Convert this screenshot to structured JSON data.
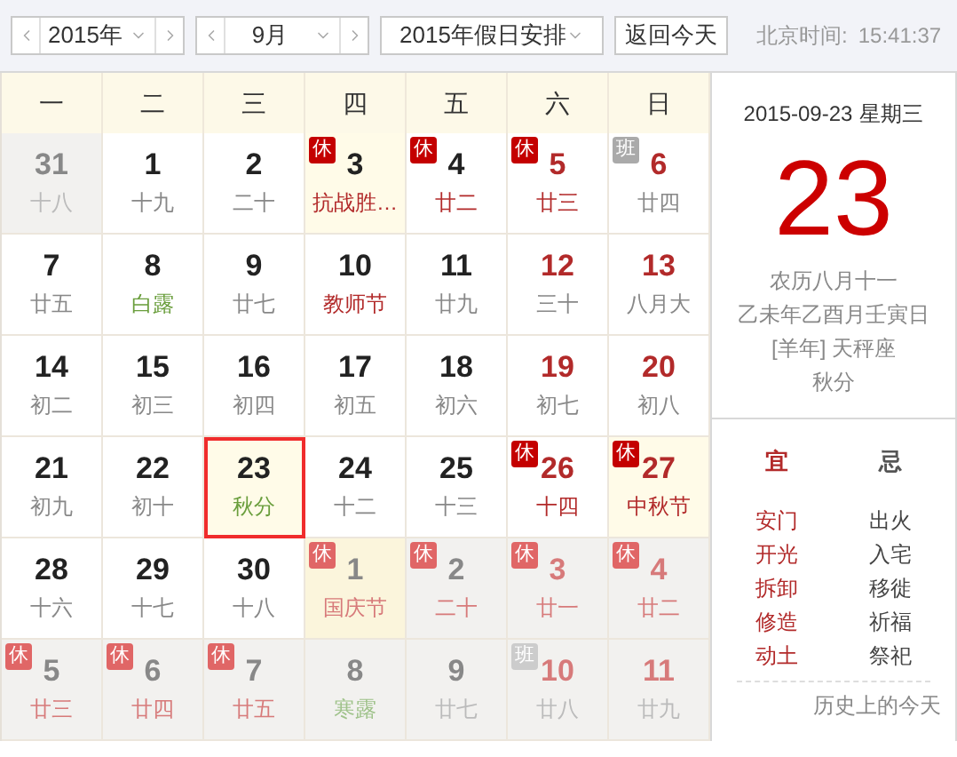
{
  "toolbar": {
    "year": "2015年",
    "month": "9月",
    "holiday_select": "2015年假日安排",
    "today_button": "返回今天",
    "clock_label": "北京时间:",
    "clock_time": "15:41:37"
  },
  "weekdays": [
    "一",
    "二",
    "三",
    "四",
    "五",
    "六",
    "日"
  ],
  "weeks": [
    [
      {
        "day": "31",
        "lunar": {
          "text": "十八",
          "kind": "plain"
        },
        "in_month": false,
        "highlight": false,
        "selected": false
      },
      {
        "day": "1",
        "lunar": {
          "text": "十九",
          "kind": "plain"
        },
        "in_month": true,
        "highlight": false,
        "selected": false
      },
      {
        "day": "2",
        "lunar": {
          "text": "二十",
          "kind": "plain"
        },
        "in_month": true,
        "highlight": false,
        "selected": false
      },
      {
        "day": "3",
        "lunar": {
          "text": "抗战胜…",
          "kind": "holiday"
        },
        "badge": {
          "text": "休",
          "kind": "rest"
        },
        "in_month": true,
        "highlight": true,
        "selected": false
      },
      {
        "day": "4",
        "lunar": {
          "text": "廿二",
          "kind": "holiday"
        },
        "badge": {
          "text": "休",
          "kind": "rest"
        },
        "in_month": true,
        "highlight": false,
        "selected": false
      },
      {
        "day": "5",
        "lunar": {
          "text": "廿三",
          "kind": "holiday"
        },
        "badge": {
          "text": "休",
          "kind": "rest"
        },
        "in_month": true,
        "highlight": false,
        "selected": false
      },
      {
        "day": "6",
        "lunar": {
          "text": "廿四",
          "kind": "plain"
        },
        "badge": {
          "text": "班",
          "kind": "work"
        },
        "in_month": true,
        "highlight": false,
        "selected": false
      }
    ],
    [
      {
        "day": "7",
        "lunar": {
          "text": "廿五",
          "kind": "plain"
        },
        "in_month": true,
        "highlight": false,
        "selected": false
      },
      {
        "day": "8",
        "lunar": {
          "text": "白露",
          "kind": "term"
        },
        "in_month": true,
        "highlight": false,
        "selected": false
      },
      {
        "day": "9",
        "lunar": {
          "text": "廿七",
          "kind": "plain"
        },
        "in_month": true,
        "highlight": false,
        "selected": false
      },
      {
        "day": "10",
        "lunar": {
          "text": "教师节",
          "kind": "holiday"
        },
        "in_month": true,
        "highlight": false,
        "selected": false
      },
      {
        "day": "11",
        "lunar": {
          "text": "廿九",
          "kind": "plain"
        },
        "in_month": true,
        "highlight": false,
        "selected": false
      },
      {
        "day": "12",
        "lunar": {
          "text": "三十",
          "kind": "plain"
        },
        "in_month": true,
        "highlight": false,
        "selected": false
      },
      {
        "day": "13",
        "lunar": {
          "text": "八月大",
          "kind": "plain"
        },
        "in_month": true,
        "highlight": false,
        "selected": false
      }
    ],
    [
      {
        "day": "14",
        "lunar": {
          "text": "初二",
          "kind": "plain"
        },
        "in_month": true,
        "highlight": false,
        "selected": false
      },
      {
        "day": "15",
        "lunar": {
          "text": "初三",
          "kind": "plain"
        },
        "in_month": true,
        "highlight": false,
        "selected": false
      },
      {
        "day": "16",
        "lunar": {
          "text": "初四",
          "kind": "plain"
        },
        "in_month": true,
        "highlight": false,
        "selected": false
      },
      {
        "day": "17",
        "lunar": {
          "text": "初五",
          "kind": "plain"
        },
        "in_month": true,
        "highlight": false,
        "selected": false
      },
      {
        "day": "18",
        "lunar": {
          "text": "初六",
          "kind": "plain"
        },
        "in_month": true,
        "highlight": false,
        "selected": false
      },
      {
        "day": "19",
        "lunar": {
          "text": "初七",
          "kind": "plain"
        },
        "in_month": true,
        "highlight": false,
        "selected": false
      },
      {
        "day": "20",
        "lunar": {
          "text": "初八",
          "kind": "plain"
        },
        "in_month": true,
        "highlight": false,
        "selected": false
      }
    ],
    [
      {
        "day": "21",
        "lunar": {
          "text": "初九",
          "kind": "plain"
        },
        "in_month": true,
        "highlight": false,
        "selected": false
      },
      {
        "day": "22",
        "lunar": {
          "text": "初十",
          "kind": "plain"
        },
        "in_month": true,
        "highlight": false,
        "selected": false
      },
      {
        "day": "23",
        "lunar": {
          "text": "秋分",
          "kind": "term"
        },
        "in_month": true,
        "highlight": true,
        "selected": true
      },
      {
        "day": "24",
        "lunar": {
          "text": "十二",
          "kind": "plain"
        },
        "in_month": true,
        "highlight": false,
        "selected": false
      },
      {
        "day": "25",
        "lunar": {
          "text": "十三",
          "kind": "plain"
        },
        "in_month": true,
        "highlight": false,
        "selected": false
      },
      {
        "day": "26",
        "lunar": {
          "text": "十四",
          "kind": "holiday"
        },
        "badge": {
          "text": "休",
          "kind": "rest"
        },
        "in_month": true,
        "highlight": false,
        "selected": false
      },
      {
        "day": "27",
        "lunar": {
          "text": "中秋节",
          "kind": "holiday"
        },
        "badge": {
          "text": "休",
          "kind": "rest"
        },
        "in_month": true,
        "highlight": true,
        "selected": false
      }
    ],
    [
      {
        "day": "28",
        "lunar": {
          "text": "十六",
          "kind": "plain"
        },
        "in_month": true,
        "highlight": false,
        "selected": false
      },
      {
        "day": "29",
        "lunar": {
          "text": "十七",
          "kind": "plain"
        },
        "in_month": true,
        "highlight": false,
        "selected": false
      },
      {
        "day": "30",
        "lunar": {
          "text": "十八",
          "kind": "plain"
        },
        "in_month": true,
        "highlight": false,
        "selected": false
      },
      {
        "day": "1",
        "lunar": {
          "text": "国庆节",
          "kind": "holiday"
        },
        "badge": {
          "text": "休",
          "kind": "rest"
        },
        "in_month": false,
        "highlight": true,
        "selected": false
      },
      {
        "day": "2",
        "lunar": {
          "text": "二十",
          "kind": "holiday"
        },
        "badge": {
          "text": "休",
          "kind": "rest"
        },
        "in_month": false,
        "highlight": false,
        "selected": false
      },
      {
        "day": "3",
        "lunar": {
          "text": "廿一",
          "kind": "holiday"
        },
        "badge": {
          "text": "休",
          "kind": "rest"
        },
        "in_month": false,
        "highlight": false,
        "selected": false
      },
      {
        "day": "4",
        "lunar": {
          "text": "廿二",
          "kind": "holiday"
        },
        "badge": {
          "text": "休",
          "kind": "rest"
        },
        "in_month": false,
        "highlight": false,
        "selected": false
      }
    ],
    [
      {
        "day": "5",
        "lunar": {
          "text": "廿三",
          "kind": "holiday"
        },
        "badge": {
          "text": "休",
          "kind": "rest"
        },
        "in_month": false,
        "highlight": false,
        "selected": false
      },
      {
        "day": "6",
        "lunar": {
          "text": "廿四",
          "kind": "holiday"
        },
        "badge": {
          "text": "休",
          "kind": "rest"
        },
        "in_month": false,
        "highlight": false,
        "selected": false
      },
      {
        "day": "7",
        "lunar": {
          "text": "廿五",
          "kind": "holiday"
        },
        "badge": {
          "text": "休",
          "kind": "rest"
        },
        "in_month": false,
        "highlight": false,
        "selected": false
      },
      {
        "day": "8",
        "lunar": {
          "text": "寒露",
          "kind": "term"
        },
        "in_month": false,
        "highlight": false,
        "selected": false
      },
      {
        "day": "9",
        "lunar": {
          "text": "廿七",
          "kind": "plain"
        },
        "in_month": false,
        "highlight": false,
        "selected": false
      },
      {
        "day": "10",
        "lunar": {
          "text": "廿八",
          "kind": "plain"
        },
        "badge": {
          "text": "班",
          "kind": "work"
        },
        "in_month": false,
        "highlight": false,
        "selected": false
      },
      {
        "day": "11",
        "lunar": {
          "text": "廿九",
          "kind": "plain"
        },
        "in_month": false,
        "highlight": false,
        "selected": false
      }
    ]
  ],
  "detail": {
    "date": "2015-09-23",
    "weekday": "星期三",
    "big_day": "23",
    "lunar_date": "农历八月十一",
    "ganzhi": "乙未年乙酉月壬寅日",
    "zodiac": "[羊年] 天秤座",
    "term": "秋分",
    "good_heading": "宜",
    "bad_heading": "忌",
    "good": [
      "安门",
      "开光",
      "拆卸",
      "修造",
      "动土"
    ],
    "bad": [
      "出火",
      "入宅",
      "移徙",
      "祈福",
      "祭祀"
    ],
    "history_link": "历史上的今天"
  }
}
